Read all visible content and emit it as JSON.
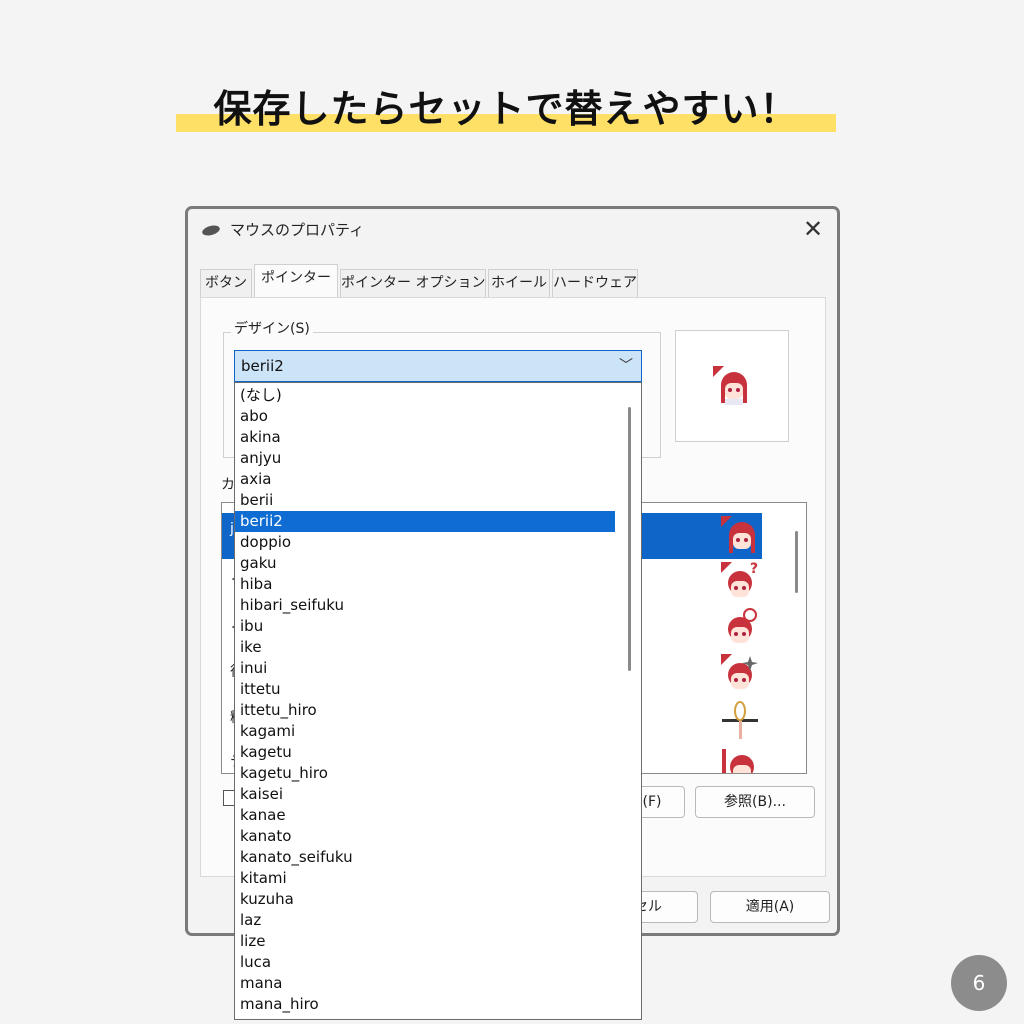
{
  "headline": "保存したらセットで替えやすい！",
  "dialog": {
    "title": "マウスのプロパティ",
    "close_glyph": "✕",
    "tabs": [
      {
        "label": "ボタン"
      },
      {
        "label": "ポインター"
      },
      {
        "label": "ポインター オプション"
      },
      {
        "label": "ホイール"
      },
      {
        "label": "ハードウェア"
      }
    ],
    "active_tab": "ポインター",
    "design_group_label": "デザイン(S)",
    "design_selected": "berii2",
    "dropdown_arrow": "﹀",
    "customize_label_partial": "カ",
    "partial_row_labels": [
      "j",
      "ノ",
      "ノ",
      "待",
      "精",
      "テ"
    ],
    "browse_button_partial": "(F)",
    "browse_button": "参照(B)...",
    "cancel_button_partial": "セル",
    "apply_button": "適用(A)"
  },
  "dropdown": {
    "items": [
      "(なし)",
      "abo",
      "akina",
      "anjyu",
      "axia",
      "berii",
      "berii2",
      "doppio",
      "gaku",
      "hiba",
      "hibari_seifuku",
      "ibu",
      "ike",
      "inui",
      "ittetu",
      "ittetu_hiro",
      "kagami",
      "kagetu",
      "kagetu_hiro",
      "kaisei",
      "kanae",
      "kanato",
      "kanato_seifuku",
      "kitami",
      "kuzuha",
      "laz",
      "lize",
      "luca",
      "mana",
      "mana_hiro"
    ],
    "selected_index": 6
  },
  "icons": {
    "title_icon": "mouse-icon",
    "preview": "anime-girl-cursor-icon",
    "list_icons": [
      "anime-girl-cursor-icon",
      "anime-girl-question-icon",
      "anime-girl-busy-icon",
      "anime-girl-spark-icon",
      "crosshair-whisk-icon",
      "anime-girl-text-icon"
    ]
  },
  "colors": {
    "highlight_yellow": "#ffe066",
    "selection_blue": "#0f66c8",
    "hair_red": "#c8323c"
  },
  "page_number": "6"
}
